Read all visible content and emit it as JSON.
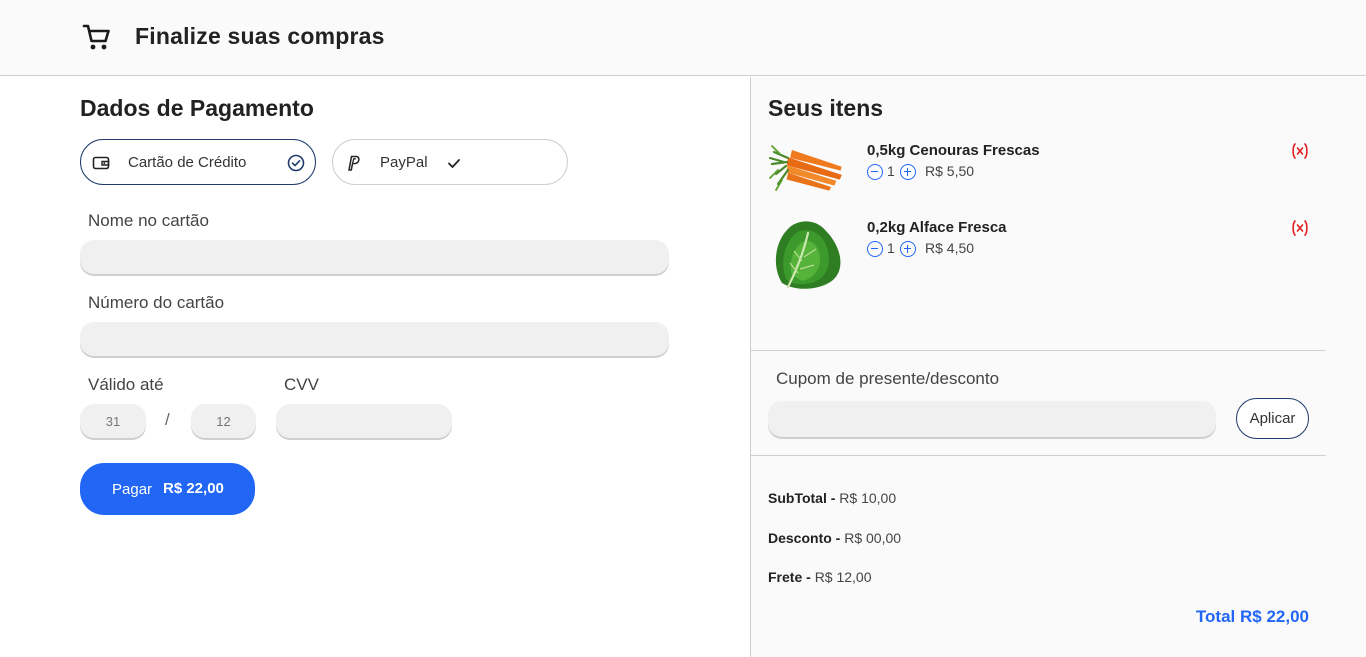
{
  "header": {
    "title": "Finalize suas compras",
    "icon": "cart-icon"
  },
  "payment": {
    "title": "Dados de Pagamento",
    "methods": [
      {
        "label": "Cartão de Crédito",
        "icon": "wallet-icon",
        "selected": true
      },
      {
        "label": "PayPal",
        "icon": "paypal-icon",
        "selected": false
      }
    ],
    "fields": {
      "name_label": "Nome no cartão",
      "number_label": "Número do cartão",
      "valid_label": "Válido até",
      "cvv_label": "CVV",
      "day_placeholder": "31",
      "month_placeholder": "12",
      "separator": "/"
    },
    "pay_button": {
      "label": "Pagar",
      "amount": "R$ 22,00"
    }
  },
  "cart": {
    "title": "Seus itens",
    "items": [
      {
        "name": "0,5kg Cenouras Frescas",
        "quantity": "1",
        "price": "R$ 5,50"
      },
      {
        "name": "0,2kg Alface Fresca",
        "quantity": "1",
        "price": "R$ 4,50"
      }
    ],
    "coupon": {
      "label": "Cupom de presente/desconto",
      "button": "Aplicar"
    },
    "summary": {
      "subtotal_label": "SubTotal -",
      "subtotal": "R$ 10,00",
      "discount_label": "Desconto -",
      "discount": "R$ 00,00",
      "shipping_label": "Frete -",
      "shipping": "R$ 12,00",
      "total": "Total R$ 22,00"
    }
  },
  "colors": {
    "accent": "#2266f5",
    "navy": "#1f3a6b",
    "remove": "#e02020"
  }
}
